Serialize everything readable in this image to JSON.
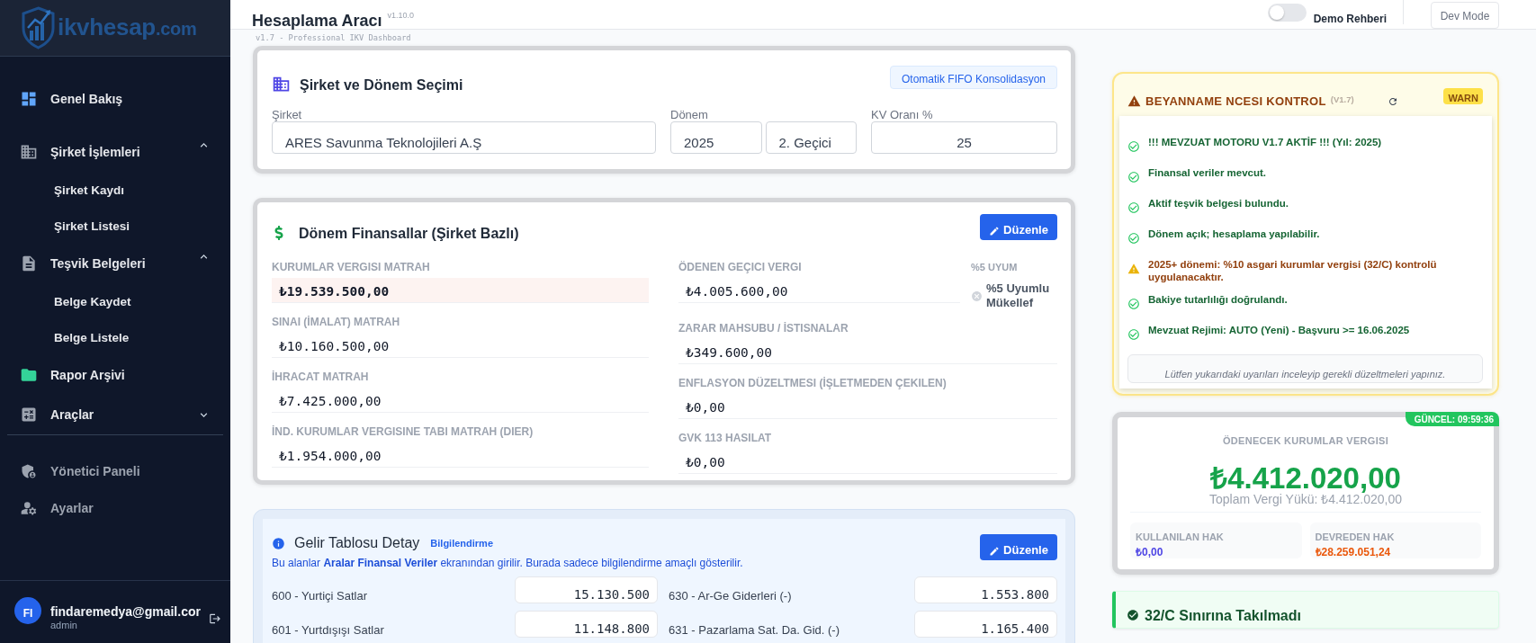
{
  "sidebar": {
    "logo": {
      "name": "ikvhesap",
      "suffix": ".com"
    },
    "items": [
      {
        "label": "Genel Bakış"
      },
      {
        "label": "Şirket İşlemleri",
        "expanded": true,
        "children": [
          {
            "label": "Şirket Kaydı"
          },
          {
            "label": "Şirket Listesi"
          }
        ]
      },
      {
        "label": "Teşvik Belgeleri",
        "expanded": true,
        "children": [
          {
            "label": "Belge Kaydet"
          },
          {
            "label": "Belge Listele"
          }
        ]
      },
      {
        "label": "Rapor Arşivi"
      },
      {
        "label": "Araçlar",
        "expanded": false
      }
    ],
    "admin_items": [
      {
        "label": "Yönetici Paneli"
      },
      {
        "label": "Ayarlar"
      }
    ],
    "user": {
      "initials": "FI",
      "email": "findaremedya@gmail.cor",
      "role": "admin"
    }
  },
  "header": {
    "title": "Hesaplama Aracı",
    "version": "v1.10.0",
    "subtitle": "v1.7 - Professional IKV Dashboard",
    "demo_guide": {
      "label": "Demo Rehberi",
      "on": false
    },
    "dev_mode_button": "Dev Mode"
  },
  "company_card": {
    "title": "Şirket ve Dönem Seçimi",
    "fifo_button": "Otomatik FIFO Konsolidasyon",
    "company": {
      "label": "Şirket",
      "value": "ARES Savunma Teknolojileri A.Ş"
    },
    "period": {
      "label": "Dönem",
      "year": "2025",
      "term": "2. Geçici"
    },
    "rate": {
      "label": "KV Oranı %",
      "value": "25"
    }
  },
  "finance_card": {
    "title": "Dönem Finansallar (Şirket Bazlı)",
    "edit_button": "Düzenle",
    "left": [
      {
        "label": "KURUMLAR VERGISI MATRAH",
        "value": "₺19.539.500,00",
        "highlighted": true
      },
      {
        "label": "SINAI (İMALAT) MATRAH",
        "value": "₺10.160.500,00",
        "highlighted": false
      },
      {
        "label": "İHRACAT MATRAH",
        "value": "₺7.425.000,00",
        "highlighted": false
      },
      {
        "label": "İND. KURUMLAR VERGISINE TABI MATRAH (DIER)",
        "value": "₺1.954.000,00",
        "highlighted": false
      }
    ],
    "right": [
      {
        "label": "ÖDENEN GEÇICI VERGI",
        "value": "₺4.005.600,00",
        "highlighted": false
      },
      {
        "label": "ZARAR MAHSUBU / İSTISNALAR",
        "value": "₺349.600,00",
        "highlighted": false
      },
      {
        "label": "ENFLASYON DÜZELTMESI (İŞLETMEDEN ÇEKILEN)",
        "value": "₺0,00",
        "highlighted": false
      },
      {
        "label": "GVK 113 HASILAT",
        "value": "₺0,00",
        "highlighted": false
      }
    ],
    "compliance": {
      "label": "%5 UYUM",
      "status": "%5 Uyumlu Mükellef",
      "met": false
    }
  },
  "income_card": {
    "title": "Gelir Tablosu Detay",
    "tag": "Bilgilendirme",
    "note": "Bu alanlar **Aralar Finansal Veriler** ekranından girilir. Burada sadece bilgilendirme amaçlı gösterilir.",
    "edit_button": "Düzenle",
    "rows": [
      {
        "label": "600 - Yurtiçi Satlar",
        "value": "15.130.500"
      },
      {
        "label": "630 - Ar-Ge Giderleri (-)",
        "value": "1.553.800"
      },
      {
        "label": "601 - Yurtdışışı Satlar",
        "value": "11.148.800"
      },
      {
        "label": "631 - Pazarlama Sat. Da. Gid. (-)",
        "value": "1.165.400"
      }
    ]
  },
  "check_panel": {
    "title": "BEYANNAME NCESI KONTROL",
    "version": "(V1.7)",
    "status": "WARN",
    "items": [
      {
        "kind": "ok",
        "text": "!!! MEVZUAT MOTORU V1.7 AKTİF !!! (Yıl: 2025)"
      },
      {
        "kind": "ok",
        "text": "Finansal veriler mevcut."
      },
      {
        "kind": "ok",
        "text": "Aktif teşvik belgesi bulundu."
      },
      {
        "kind": "ok",
        "text": "Dönem açık; hesaplama yapılabilir."
      },
      {
        "kind": "warn",
        "text": "2025+ dönemi: %10 asgari kurumlar vergisi (32/C) kontrolü uygulanacaktır."
      },
      {
        "kind": "ok",
        "text": "Bakiye tutarlılığı doğrulandı."
      },
      {
        "kind": "ok",
        "text": "Mevzuat Rejimi: AUTO (Yeni) - Başvuru >= 16.06.2025"
      }
    ],
    "footer": "Lütfen yukarıdaki uyarıları inceleyip gerekli düzeltmeleri yapınız."
  },
  "tax_card": {
    "badge": "GÜNCEL: 09:59:36",
    "title": "ÖDENECEK KURUMLAR VERGISI",
    "amount": "₺4.412.020,00",
    "total": "Toplam Vergi Yükü: ₺4.412.020,00",
    "stats": [
      {
        "label": "KULLANILAN HAK",
        "value": "₺0,00",
        "color": "#4f46e5"
      },
      {
        "label": "DEVREDEN HAK",
        "value": "₺28.259.051,24",
        "color": "#ea580c"
      }
    ]
  },
  "limit_card": {
    "title": "32/C Sınırına Takılmadı",
    "passed": true
  }
}
